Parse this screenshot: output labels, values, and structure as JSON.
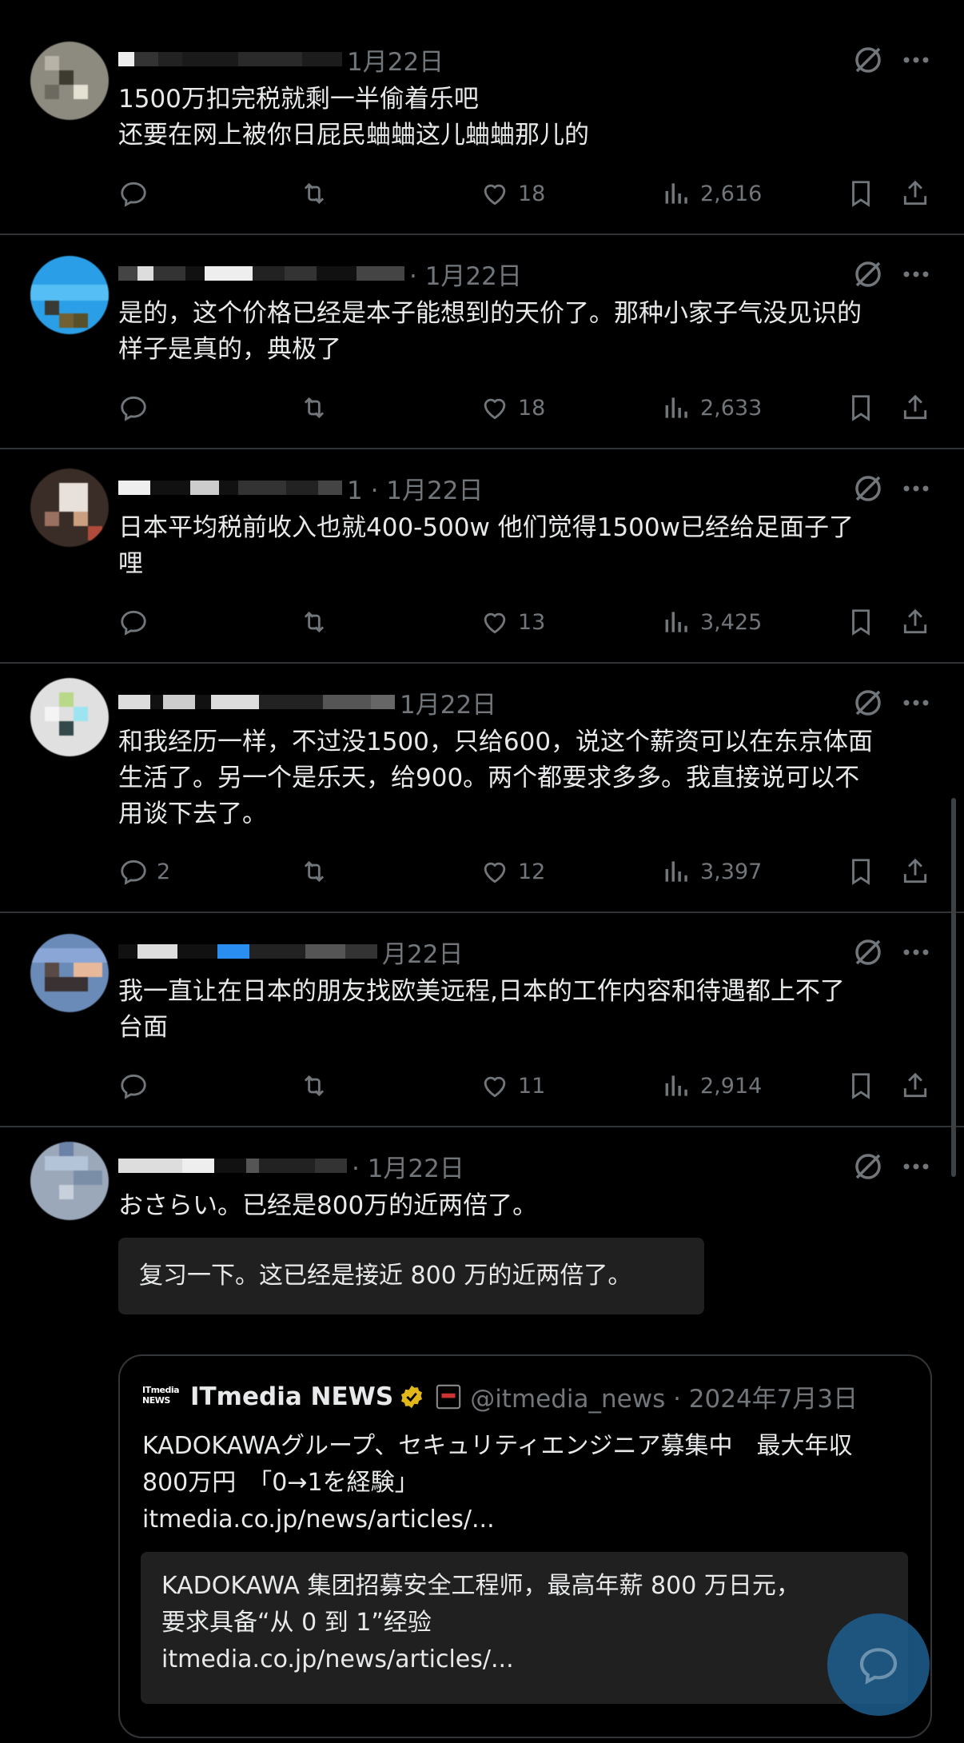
{
  "posts": [
    {
      "date": "1月22日",
      "text": "1500万扣完税就剩一半偷着乐吧\n还要在网上被你日屁民蛐蛐这儿蛐蛐那儿的",
      "replies": "",
      "likes": "18",
      "views": "2,616"
    },
    {
      "date": "· 1月22日",
      "text": "是的，这个价格已经是本子能想到的天价了。那种小家子气没见识的\n样子是真的，典极了",
      "replies": "",
      "likes": "18",
      "views": "2,633"
    },
    {
      "date": "1 · 1月22日",
      "text": "日本平均税前收入也就400-500w 他们觉得1500w已经给足面子了\n哩",
      "replies": "",
      "likes": "13",
      "views": "3,425"
    },
    {
      "date": "1月22日",
      "text": "和我经历一样，不过没1500，只给600，说这个薪资可以在东京体面\n生活了。另一个是乐天，给900。两个都要求多多。我直接说可以不\n用谈下去了。",
      "replies": "2",
      "likes": "12",
      "views": "3,397"
    },
    {
      "date": "月22日",
      "text": "我一直让在日本的朋友找欧美远程,日本的工作内容和待遇都上不了\n台面",
      "replies": "",
      "likes": "11",
      "views": "2,914"
    },
    {
      "date": "· 1月22日",
      "text": "おさらい。已经是800万的近两倍了。",
      "translation": "复习一下。这已经是接近 800 万的近两倍了。"
    }
  ],
  "quote": {
    "logo_text": "ITmedia NEWS",
    "name": "ITmedia NEWS",
    "handle": "@itmedia_news · 2024年7月3日",
    "text": "KADOKAWAグループ、セキュリティエンジニア募集中　最大年収\n800万円　「0→1を経験」\nitmedia.co.jp/news/articles/...",
    "translation": "KADOKAWA 集团招募安全工程师，最高年薪 800 万日元，\n要求具备“从 0 到 1”经验\nitmedia.co.jp/news/articles/..."
  },
  "colors": {
    "background": "#000000",
    "text": "#e7e9ea",
    "muted": "#71767b",
    "divider": "#2f3336",
    "verified": "#e2b719",
    "fab": "#1d9bf0"
  },
  "icons": [
    "reply-icon",
    "retweet-icon",
    "like-icon",
    "views-icon",
    "bookmark-icon",
    "share-icon",
    "grok-icon",
    "more-icon",
    "verified-badge-icon",
    "compose-reply-icon"
  ]
}
